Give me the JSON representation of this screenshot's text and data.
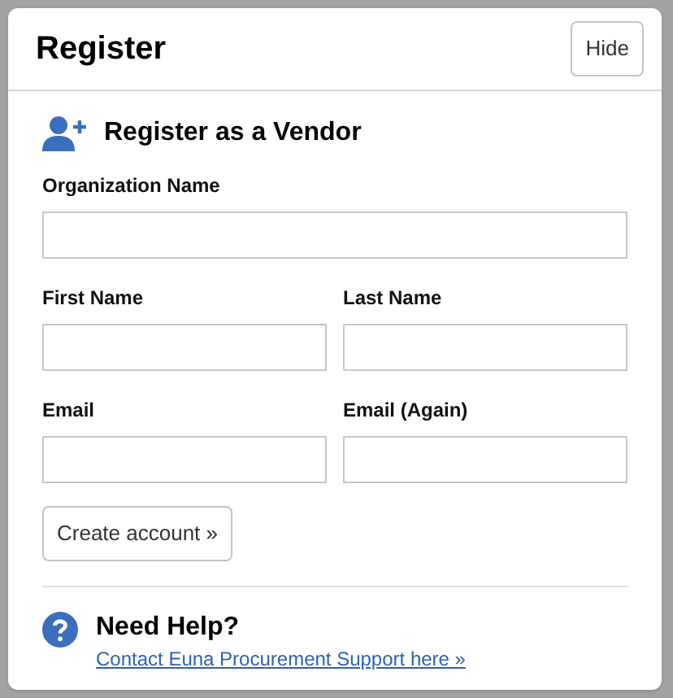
{
  "dialog": {
    "title": "Register",
    "hide_button": "Hide"
  },
  "section": {
    "heading": "Register as a Vendor"
  },
  "fields": [
    {
      "label": "Organization Name"
    },
    {
      "label": "First Name"
    },
    {
      "label": "Last Name"
    },
    {
      "label": "Email"
    },
    {
      "label": "Email (Again)"
    }
  ],
  "submit_button": "Create account »",
  "help": {
    "heading": "Need Help?",
    "link": "Contact Euna Procurement Support here »"
  }
}
